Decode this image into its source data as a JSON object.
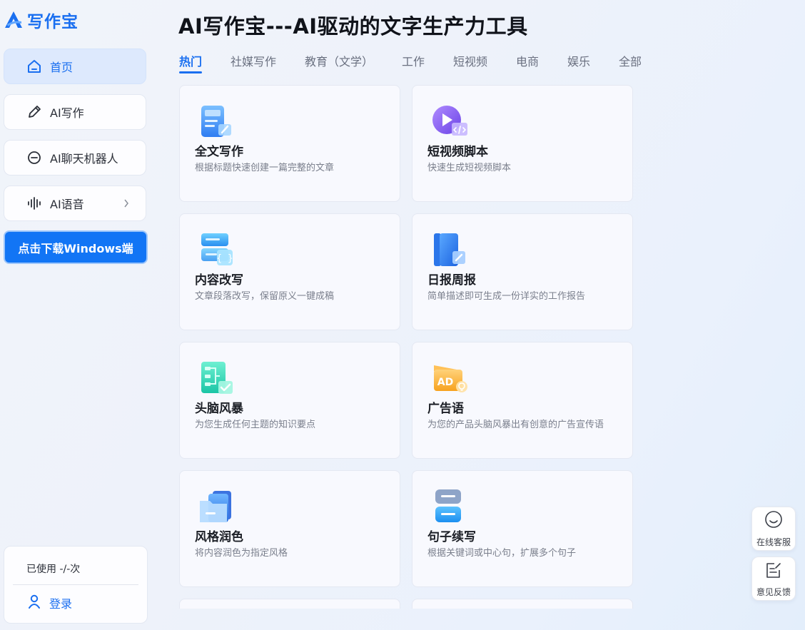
{
  "brand": {
    "name": "写作宝",
    "color": "#1a6ff0"
  },
  "sidebar": {
    "items": [
      {
        "label": "首页",
        "icon": "home-icon",
        "active": true
      },
      {
        "label": "AI写作",
        "icon": "pencil-icon"
      },
      {
        "label": "AI聊天机器人",
        "icon": "chat-icon"
      },
      {
        "label": "AI语音",
        "icon": "voice-wave-icon",
        "expandable": true
      }
    ],
    "download_label": "点击下载Windows端",
    "usage_text": "已使用 -/-次",
    "login_label": "登录"
  },
  "main": {
    "title": "AI写作宝---AI驱动的文字生产力工具",
    "tabs": [
      {
        "label": "热门",
        "active": true
      },
      {
        "label": "社媒写作"
      },
      {
        "label": "教育（文学）"
      },
      {
        "label": "工作"
      },
      {
        "label": "短视频"
      },
      {
        "label": "电商"
      },
      {
        "label": "娱乐"
      },
      {
        "label": "全部"
      }
    ],
    "cards": [
      {
        "title": "全文写作",
        "desc": "根据标题快速创建一篇完整的文章",
        "icon": "document-write-icon"
      },
      {
        "title": "短视频脚本",
        "desc": "快速生成短视频脚本",
        "icon": "video-script-icon"
      },
      {
        "title": "内容改写",
        "desc": "文章段落改写，保留原义一键成稿",
        "icon": "content-rewrite-icon"
      },
      {
        "title": "日报周报",
        "desc": "简单描述即可生成一份详实的工作报告",
        "icon": "report-icon"
      },
      {
        "title": "头脑风暴",
        "desc": "为您生成任何主题的知识要点",
        "icon": "brainstorm-icon"
      },
      {
        "title": "广告语",
        "desc": "为您的产品头脑风暴出有创意的广告宣传语",
        "icon": "ad-slogan-icon"
      },
      {
        "title": "风格润色",
        "desc": "将内容润色为指定风格",
        "icon": "style-polish-icon"
      },
      {
        "title": "句子续写",
        "desc": "根据关键词或中心句，扩展多个句子",
        "icon": "sentence-continue-icon"
      }
    ]
  },
  "floating": {
    "service_label": "在线客服",
    "feedback_label": "意见反馈"
  }
}
